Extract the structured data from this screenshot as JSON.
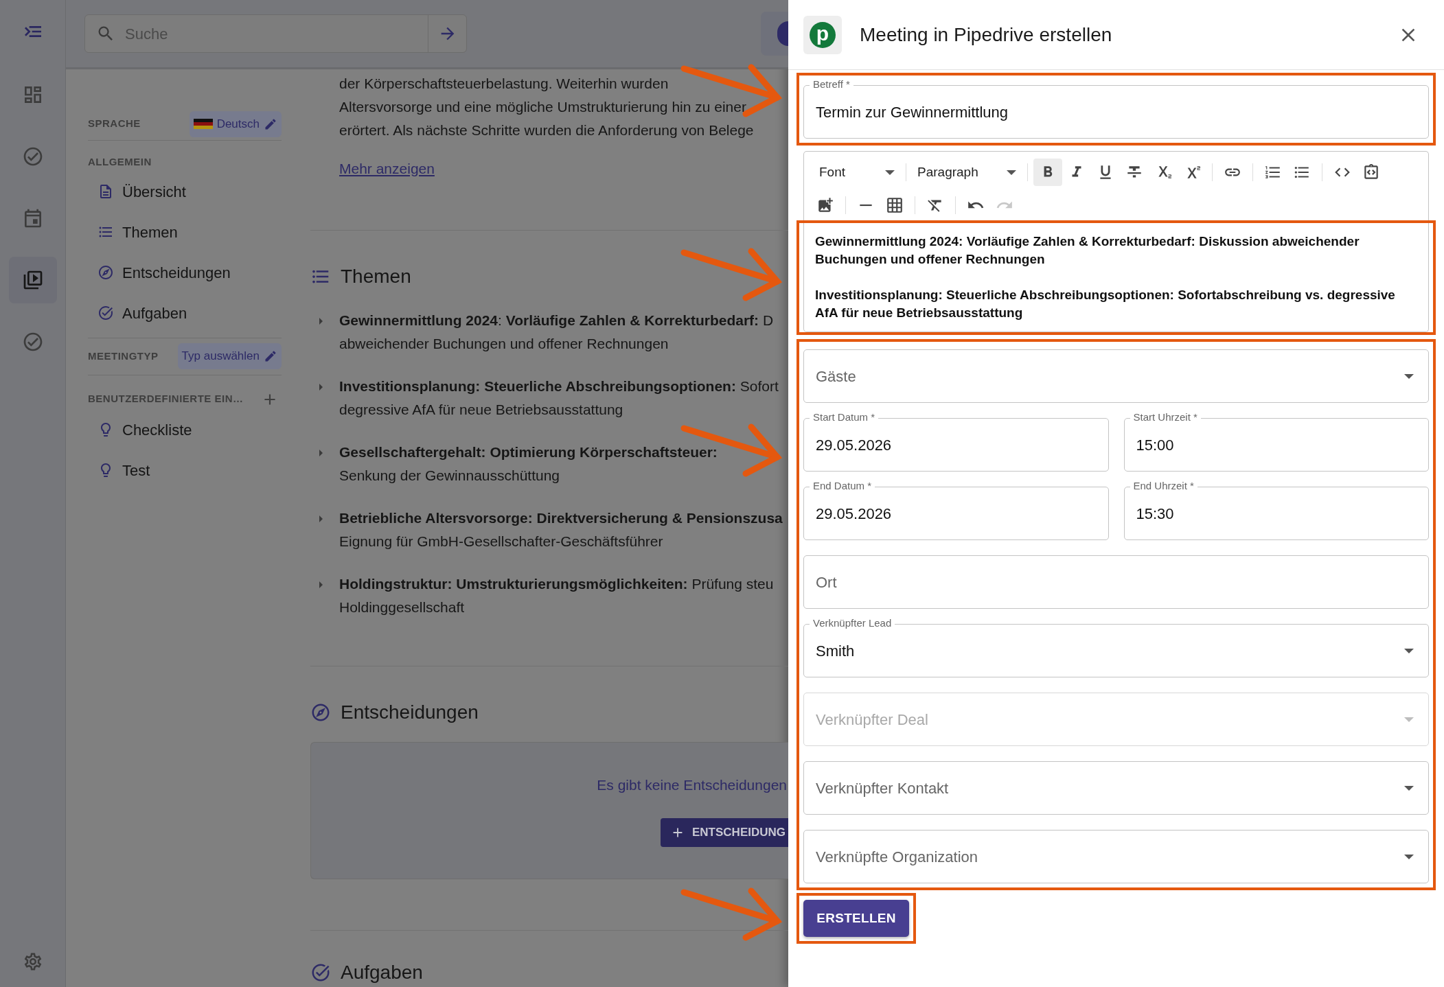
{
  "rail": {
    "items": [
      {
        "kind": "dashboard",
        "selected": false
      },
      {
        "kind": "check",
        "selected": false
      },
      {
        "kind": "calendar",
        "selected": false
      },
      {
        "kind": "video",
        "selected": true
      },
      {
        "kind": "check",
        "selected": false
      }
    ]
  },
  "search": {
    "placeholder": "Suche"
  },
  "sidebar": {
    "language": {
      "label": "SPRACHE",
      "value": "Deutsch"
    },
    "general": {
      "label": "ALLGEMEIN",
      "items": [
        {
          "kind": "doc",
          "label": "Übersicht"
        },
        {
          "kind": "list",
          "label": "Themen"
        },
        {
          "kind": "compass",
          "label": "Entscheidungen"
        },
        {
          "kind": "task",
          "label": "Aufgaben"
        }
      ]
    },
    "meeting_type": {
      "label": "MEETINGTYP",
      "value": "Typ auswählen"
    },
    "custom": {
      "label": "BENUTZERDEFINIERTE EIN…",
      "items": [
        {
          "kind": "bulb",
          "label": "Checkliste"
        },
        {
          "kind": "bulb",
          "label": "Test"
        }
      ]
    }
  },
  "main": {
    "summary_lines": [
      "der Körperschaftsteuerbelastung. Weiterhin wurden",
      "Altersvorsorge und eine mögliche Umstrukturierung hin zu einer",
      "erörtert. Als nächste Schritte wurden die Anforderung von Belege"
    ],
    "more_link": "Mehr anzeigen",
    "topics_heading": "Themen",
    "topics": [
      {
        "line1": "**Gewinnermittlung 2024**: **Vorläufige Zahlen & Korrekturbedarf:** D",
        "line2": "abweichender Buchungen und offener Rechnungen"
      },
      {
        "line1": "**Investitionsplanung: Steuerliche Abschreibungsoptionen:** Sofort",
        "line2": "degressive AfA für neue Betriebsausstattung"
      },
      {
        "line1": "**Gesellschaftergehalt: Optimierung Körperschaftsteuer:**",
        "line2": "Senkung der Gewinnausschüttung"
      },
      {
        "line1": "**Betriebliche Altersvorsorge: Direktversicherung & Pensionszusa**",
        "line2": "Eignung für GmbH-Gesellschafter-Geschäftsführer"
      },
      {
        "line1": "**Holdingstruktur: Umstrukturierungsmöglichkeiten:** Prüfung steu",
        "line2": "Holdinggesellschaft"
      }
    ],
    "decisions_heading": "Entscheidungen",
    "decisions_empty": "Es gibt keine Entscheidungen",
    "decisions_button": "ENTSCHEIDUNG",
    "tasks_heading": "Aufgaben"
  },
  "dialog": {
    "logo": "p",
    "title": "Meeting in Pipedrive erstellen",
    "subject": {
      "label": "Betreff *",
      "value": "Termin zur Gewinnermittlung"
    },
    "toolbar": {
      "font": "Font",
      "paragraph": "Paragraph",
      "groups": [
        [
          {
            "kind": "bold",
            "active": true,
            "disabled": false
          },
          {
            "kind": "italic",
            "active": false,
            "disabled": false
          },
          {
            "kind": "underline",
            "active": false,
            "disabled": false
          },
          {
            "kind": "strike",
            "active": false,
            "disabled": false
          },
          {
            "kind": "subscript",
            "active": false,
            "disabled": false
          },
          {
            "kind": "superscript",
            "active": false,
            "disabled": false
          }
        ],
        [
          {
            "kind": "link",
            "active": false,
            "disabled": false
          }
        ],
        [
          {
            "kind": "ordered",
            "active": false,
            "disabled": false
          },
          {
            "kind": "bullets",
            "active": false,
            "disabled": false
          }
        ],
        [
          {
            "kind": "code",
            "active": false,
            "disabled": false
          },
          {
            "kind": "codeblock",
            "active": false,
            "disabled": false
          }
        ],
        [
          {
            "kind": "image",
            "active": false,
            "disabled": false
          }
        ],
        [
          {
            "kind": "rule",
            "active": false,
            "disabled": false
          },
          {
            "kind": "table",
            "active": false,
            "disabled": false
          }
        ],
        [
          {
            "kind": "clear",
            "active": false,
            "disabled": false
          }
        ],
        [
          {
            "kind": "undo",
            "active": false,
            "disabled": false
          },
          {
            "kind": "redo",
            "active": false,
            "disabled": true
          }
        ]
      ]
    },
    "body": [
      "Gewinnermittlung 2024: Vorläufige Zahlen & Korrekturbedarf: Diskussion abweichender Buchungen und offener Rechnungen",
      "Investitionsplanung: Steuerliche Abschreibungsoptionen: Sofortabschreibung vs. degressive AfA für neue Betriebsausstattung"
    ],
    "rows": [
      [
        {
          "kind": "select",
          "placeholder": "Gäste",
          "disabled": false
        }
      ],
      [
        {
          "kind": "text",
          "label": "Start Datum *",
          "value": "29.05.2026",
          "disabled": false
        },
        {
          "kind": "text",
          "label": "Start Uhrzeit *",
          "value": "15:00",
          "disabled": false
        }
      ],
      [
        {
          "kind": "text",
          "label": "End Datum *",
          "value": "29.05.2026",
          "disabled": false
        },
        {
          "kind": "text",
          "label": "End Uhrzeit *",
          "value": "15:30",
          "disabled": false
        }
      ],
      [
        {
          "kind": "text",
          "placeholder": "Ort",
          "disabled": false
        }
      ],
      [
        {
          "kind": "select",
          "label": "Verknüpfter Lead",
          "value": "Smith",
          "disabled": false
        }
      ],
      [
        {
          "kind": "select",
          "placeholder": "Verknüpfter Deal",
          "disabled": true
        }
      ],
      [
        {
          "kind": "select",
          "placeholder": "Verknüpfter Kontakt",
          "disabled": false
        }
      ],
      [
        {
          "kind": "select",
          "placeholder": "Verknüpfte Organization",
          "disabled": false
        }
      ]
    ],
    "submit": "ERSTELLEN"
  }
}
